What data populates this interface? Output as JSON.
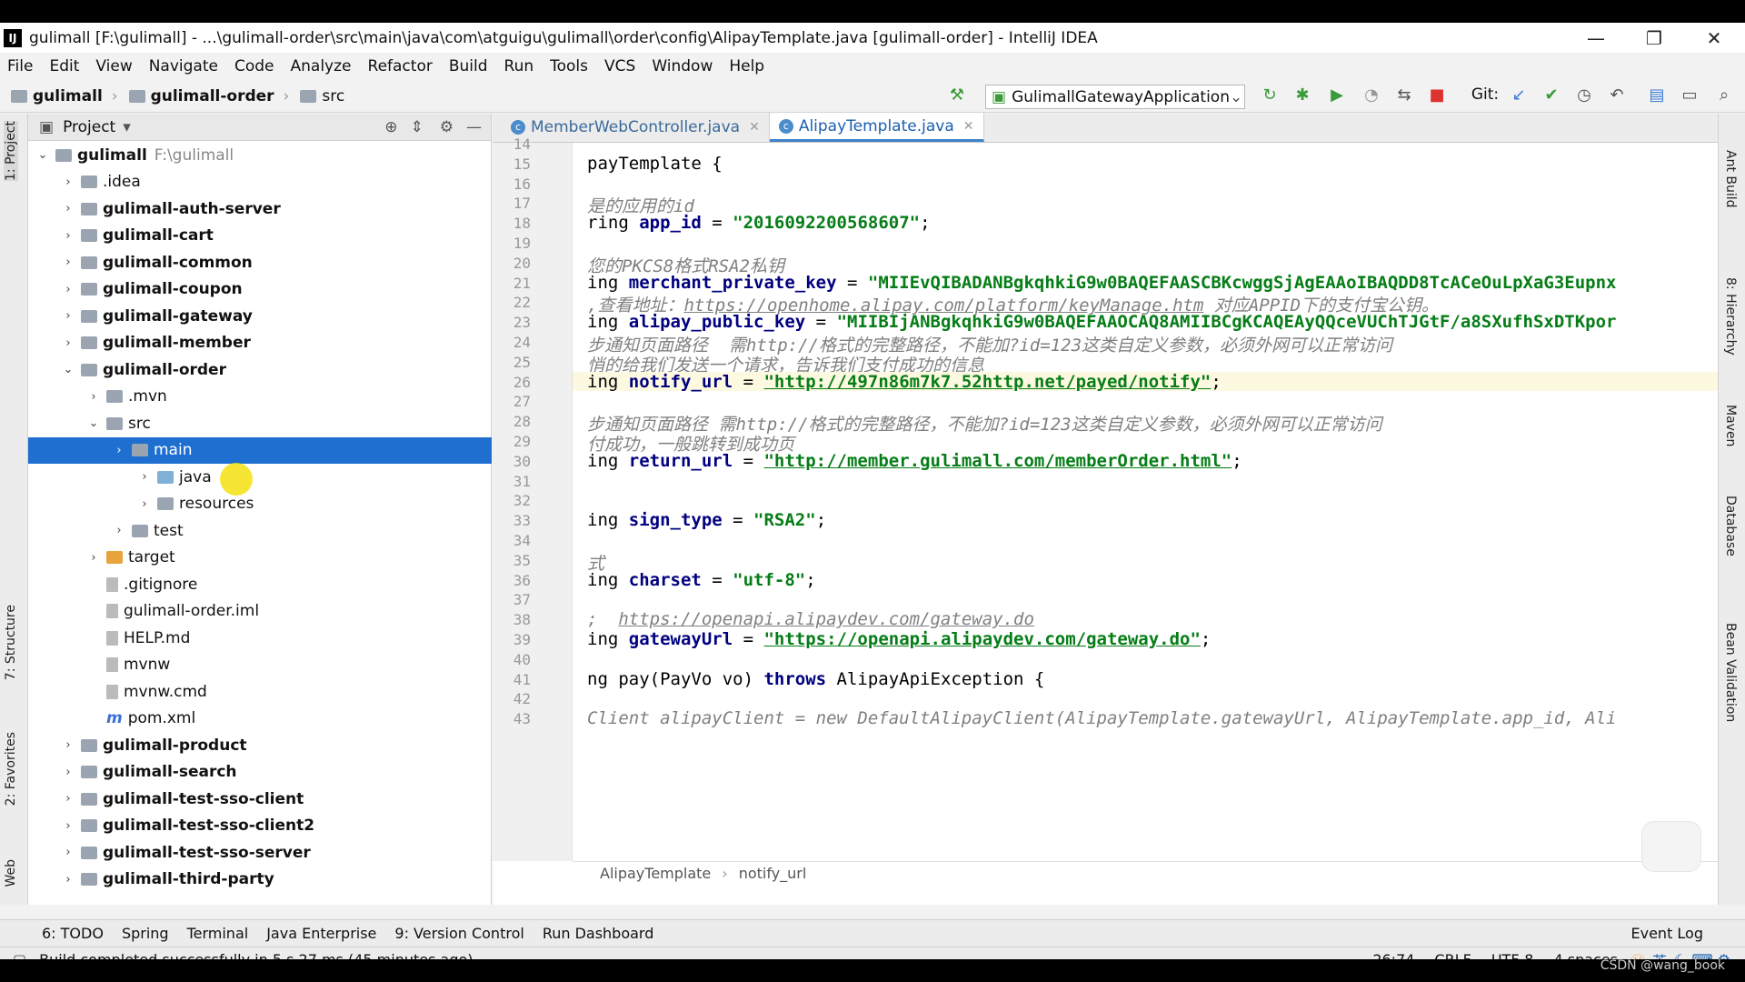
{
  "window": {
    "title": "gulimall [F:\\gulimall] - ...\\gulimall-order\\src\\main\\java\\com\\atguigu\\gulimall\\order\\config\\AlipayTemplate.java [gulimall-order] - IntelliJ IDEA",
    "app_icon": "IJ"
  },
  "menu": [
    "File",
    "Edit",
    "View",
    "Navigate",
    "Code",
    "Analyze",
    "Refactor",
    "Build",
    "Run",
    "Tools",
    "VCS",
    "Window",
    "Help"
  ],
  "navbar": {
    "crumbs": [
      "gulimall",
      "gulimall-order",
      "src"
    ],
    "run_config": "GulimallGatewayApplication",
    "git_label": "Git:"
  },
  "project": {
    "header": "Project",
    "root_name": "gulimall",
    "root_path": "F:\\gulimall",
    "items": [
      {
        "label": "gulimall",
        "path": "F:\\gulimall",
        "depth": 0,
        "open": true,
        "bold": true,
        "kind": "folder"
      },
      {
        "label": ".idea",
        "depth": 1,
        "open": false,
        "bold": false,
        "kind": "folder"
      },
      {
        "label": "gulimall-auth-server",
        "depth": 1,
        "open": false,
        "bold": true,
        "kind": "folder"
      },
      {
        "label": "gulimall-cart",
        "depth": 1,
        "open": false,
        "bold": true,
        "kind": "folder"
      },
      {
        "label": "gulimall-common",
        "depth": 1,
        "open": false,
        "bold": true,
        "kind": "folder"
      },
      {
        "label": "gulimall-coupon",
        "depth": 1,
        "open": false,
        "bold": true,
        "kind": "folder"
      },
      {
        "label": "gulimall-gateway",
        "depth": 1,
        "open": false,
        "bold": true,
        "kind": "folder"
      },
      {
        "label": "gulimall-member",
        "depth": 1,
        "open": false,
        "bold": true,
        "kind": "folder"
      },
      {
        "label": "gulimall-order",
        "depth": 1,
        "open": true,
        "bold": true,
        "kind": "folder"
      },
      {
        "label": ".mvn",
        "depth": 2,
        "open": false,
        "bold": false,
        "kind": "folder"
      },
      {
        "label": "src",
        "depth": 2,
        "open": true,
        "bold": false,
        "kind": "folder"
      },
      {
        "label": "main",
        "depth": 3,
        "open": false,
        "bold": false,
        "kind": "folder",
        "selected": true
      },
      {
        "label": "java",
        "depth": 4,
        "open": false,
        "bold": false,
        "kind": "folder-blue"
      },
      {
        "label": "resources",
        "depth": 4,
        "open": false,
        "bold": false,
        "kind": "folder"
      },
      {
        "label": "test",
        "depth": 3,
        "open": false,
        "bold": false,
        "kind": "folder"
      },
      {
        "label": "target",
        "depth": 2,
        "open": false,
        "bold": false,
        "kind": "folder-orange"
      },
      {
        "label": ".gitignore",
        "depth": 2,
        "bold": false,
        "kind": "file"
      },
      {
        "label": "gulimall-order.iml",
        "depth": 2,
        "bold": false,
        "kind": "file"
      },
      {
        "label": "HELP.md",
        "depth": 2,
        "bold": false,
        "kind": "file"
      },
      {
        "label": "mvnw",
        "depth": 2,
        "bold": false,
        "kind": "file"
      },
      {
        "label": "mvnw.cmd",
        "depth": 2,
        "bold": false,
        "kind": "file"
      },
      {
        "label": "pom.xml",
        "depth": 2,
        "bold": false,
        "kind": "maven"
      },
      {
        "label": "gulimall-product",
        "depth": 1,
        "open": false,
        "bold": true,
        "kind": "folder"
      },
      {
        "label": "gulimall-search",
        "depth": 1,
        "open": false,
        "bold": true,
        "kind": "folder"
      },
      {
        "label": "gulimall-test-sso-client",
        "depth": 1,
        "open": false,
        "bold": true,
        "kind": "folder"
      },
      {
        "label": "gulimall-test-sso-client2",
        "depth": 1,
        "open": false,
        "bold": true,
        "kind": "folder"
      },
      {
        "label": "gulimall-test-sso-server",
        "depth": 1,
        "open": false,
        "bold": true,
        "kind": "folder"
      },
      {
        "label": "gulimall-third-party",
        "depth": 1,
        "open": false,
        "bold": true,
        "kind": "folder"
      }
    ]
  },
  "editor": {
    "tabs": [
      {
        "label": "MemberWebController.java",
        "active": false
      },
      {
        "label": "AlipayTemplate.java",
        "active": true
      }
    ],
    "lines": [
      {
        "n": "14",
        "parts": []
      },
      {
        "n": "15",
        "parts": [
          {
            "t": "payTemplate {",
            "c": "plain"
          }
        ]
      },
      {
        "n": "16",
        "parts": []
      },
      {
        "n": "17",
        "parts": [
          {
            "t": "是的应用的id",
            "c": "cmt"
          }
        ]
      },
      {
        "n": "18",
        "parts": [
          {
            "t": "ring ",
            "c": "plain"
          },
          {
            "t": "app_id",
            "c": "kw"
          },
          {
            "t": " = ",
            "c": "plain"
          },
          {
            "t": "\"2016092200568607\"",
            "c": "str"
          },
          {
            "t": ";",
            "c": "plain"
          }
        ]
      },
      {
        "n": "19",
        "parts": []
      },
      {
        "n": "20",
        "parts": [
          {
            "t": "您的PKCS8格式RSA2私钥",
            "c": "cmt"
          }
        ]
      },
      {
        "n": "21",
        "parts": [
          {
            "t": "ing ",
            "c": "plain"
          },
          {
            "t": "merchant_private_key",
            "c": "kw"
          },
          {
            "t": " = ",
            "c": "plain"
          },
          {
            "t": "\"MIIEvQIBADANBgkqhkiG9w0BAQEFAASCBKcwggSjAgEAAoIBAQDD8TcACeOuLpXaG3Eupnx",
            "c": "str"
          }
        ]
      },
      {
        "n": "22",
        "parts": [
          {
            "t": ",查看地址：",
            "c": "cmt"
          },
          {
            "t": "https://openhome.alipay.com/platform/keyManage.htm",
            "c": "cmtlink"
          },
          {
            "t": " 对应APPID下的支付宝公钥。",
            "c": "cmt"
          }
        ]
      },
      {
        "n": "23",
        "parts": [
          {
            "t": "ing ",
            "c": "plain"
          },
          {
            "t": "alipay_public_key",
            "c": "kw"
          },
          {
            "t": " = ",
            "c": "plain"
          },
          {
            "t": "\"MIIBIjANBgkqhkiG9w0BAQEFAAOCAQ8AMIIBCgKCAQEAyQQceVUChTJGtF/a8SXufhSxDTKpor",
            "c": "str"
          }
        ]
      },
      {
        "n": "24",
        "parts": [
          {
            "t": "步通知页面路径  需http://格式的完整路径，不能加?id=123这类自定义参数，必须外网可以正常访问",
            "c": "cmt"
          }
        ]
      },
      {
        "n": "25",
        "parts": [
          {
            "t": "悄的给我们发送一个请求，告诉我们支付成功的信息",
            "c": "cmt"
          }
        ]
      },
      {
        "n": "26",
        "hl": true,
        "parts": [
          {
            "t": "ing ",
            "c": "plain"
          },
          {
            "t": "notify_url",
            "c": "kw"
          },
          {
            "t": " = ",
            "c": "plain"
          },
          {
            "t": "\"http://497n86m7k7.52http.net/payed/notify\"",
            "c": "link"
          },
          {
            "t": ";",
            "c": "plain"
          }
        ]
      },
      {
        "n": "27",
        "parts": []
      },
      {
        "n": "28",
        "parts": [
          {
            "t": "步通知页面路径 需http://格式的完整路径，不能加?id=123这类自定义参数，必须外网可以正常访问",
            "c": "cmt"
          }
        ]
      },
      {
        "n": "29",
        "parts": [
          {
            "t": "付成功，一般跳转到成功页",
            "c": "cmt"
          }
        ]
      },
      {
        "n": "30",
        "parts": [
          {
            "t": "ing ",
            "c": "plain"
          },
          {
            "t": "return_url",
            "c": "kw"
          },
          {
            "t": " = ",
            "c": "plain"
          },
          {
            "t": "\"http://member.gulimall.com/memberOrder.html\"",
            "c": "link"
          },
          {
            "t": ";",
            "c": "plain"
          }
        ]
      },
      {
        "n": "31",
        "parts": []
      },
      {
        "n": "32",
        "parts": []
      },
      {
        "n": "33",
        "parts": [
          {
            "t": "ing ",
            "c": "plain"
          },
          {
            "t": "sign_type",
            "c": "kw"
          },
          {
            "t": " = ",
            "c": "plain"
          },
          {
            "t": "\"RSA2\"",
            "c": "str"
          },
          {
            "t": ";",
            "c": "plain"
          }
        ]
      },
      {
        "n": "34",
        "parts": []
      },
      {
        "n": "35",
        "parts": [
          {
            "t": "式",
            "c": "cmt"
          }
        ]
      },
      {
        "n": "36",
        "parts": [
          {
            "t": "ing ",
            "c": "plain"
          },
          {
            "t": "charset",
            "c": "kw"
          },
          {
            "t": " = ",
            "c": "plain"
          },
          {
            "t": "\"utf-8\"",
            "c": "str"
          },
          {
            "t": ";",
            "c": "plain"
          }
        ]
      },
      {
        "n": "37",
        "parts": []
      },
      {
        "n": "38",
        "parts": [
          {
            "t": ";  ",
            "c": "cmt"
          },
          {
            "t": "https://openapi.alipaydev.com/gateway.do",
            "c": "cmtlink"
          }
        ]
      },
      {
        "n": "39",
        "parts": [
          {
            "t": "ing ",
            "c": "plain"
          },
          {
            "t": "gatewayUrl",
            "c": "kw"
          },
          {
            "t": " = ",
            "c": "plain"
          },
          {
            "t": "\"https://openapi.alipaydev.com/gateway.do\"",
            "c": "link"
          },
          {
            "t": ";",
            "c": "plain"
          }
        ]
      },
      {
        "n": "40",
        "parts": []
      },
      {
        "n": "41",
        "parts": [
          {
            "t": "ng pay(PayVo vo) ",
            "c": "plain"
          },
          {
            "t": "throws",
            "c": "kw"
          },
          {
            "t": " AlipayApiException {",
            "c": "plain"
          }
        ]
      },
      {
        "n": "42",
        "parts": []
      },
      {
        "n": "43",
        "parts": [
          {
            "t": "Client alipayClient = new DefaultAlipayClient(AlipayTemplate.gatewayUrl, AlipayTemplate.app_id, Ali",
            "c": "cmt"
          }
        ]
      }
    ],
    "breadcrumb": [
      "AlipayTemplate",
      "notify_url"
    ]
  },
  "left_tabs": [
    "1: Project",
    "7: Structure",
    "2: Favorites",
    "Web"
  ],
  "right_tabs": [
    "Ant Build",
    "8: Hierarchy",
    "Maven",
    "Database",
    "Bean Validation"
  ],
  "bottom_tabs": [
    "6: TODO",
    "Spring",
    "Terminal",
    "Java Enterprise",
    "9: Version Control",
    "Run Dashboard"
  ],
  "event_log": "Event Log",
  "status": {
    "message": "Build completed successfully in 5 s 27 ms (45 minutes ago)",
    "position": "26:74",
    "line_sep": "CRLF",
    "encoding": "UTF-8",
    "indent": "4 spaces",
    "ime": "英"
  },
  "watermark": "CSDN @wang_book"
}
